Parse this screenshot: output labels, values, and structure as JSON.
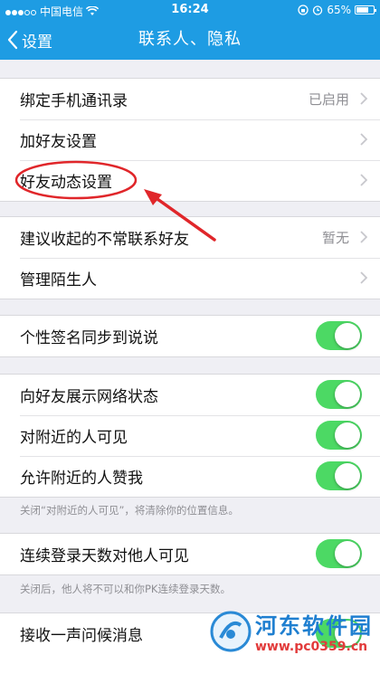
{
  "status_bar": {
    "carrier": "中国电信",
    "time": "16:24",
    "battery": "65%"
  },
  "nav": {
    "back_label": "设置",
    "title": "联系人、隐私"
  },
  "group1": {
    "rows": [
      {
        "label": "绑定手机通讯录",
        "value": "已启用"
      },
      {
        "label": "加好友设置"
      },
      {
        "label": "好友动态设置"
      }
    ]
  },
  "group2": {
    "rows": [
      {
        "label": "建议收起的不常联系好友",
        "value": "暂无"
      },
      {
        "label": "管理陌生人"
      }
    ]
  },
  "group3": {
    "rows": [
      {
        "label": "个性签名同步到说说",
        "toggle": true
      }
    ]
  },
  "group4": {
    "rows": [
      {
        "label": "向好友展示网络状态",
        "toggle": true
      },
      {
        "label": "对附近的人可见",
        "toggle": true
      },
      {
        "label": "允许附近的人赞我",
        "toggle": true
      }
    ],
    "note": "关闭“对附近的人可见”，将清除你的位置信息。"
  },
  "group5": {
    "rows": [
      {
        "label": "连续登录天数对他人可见",
        "toggle": true
      }
    ],
    "note": "关闭后，他人将不可以和你PK连续登录天数。"
  },
  "group6": {
    "rows": [
      {
        "label": "接收一声问候消息",
        "toggle": true
      }
    ]
  },
  "watermark": {
    "title": "河东软件园",
    "url": "www.pc0359.cn"
  },
  "colors": {
    "nav_blue": "#1e9ce3",
    "toggle_green": "#4cd964",
    "annotation_red": "#e0262a"
  }
}
